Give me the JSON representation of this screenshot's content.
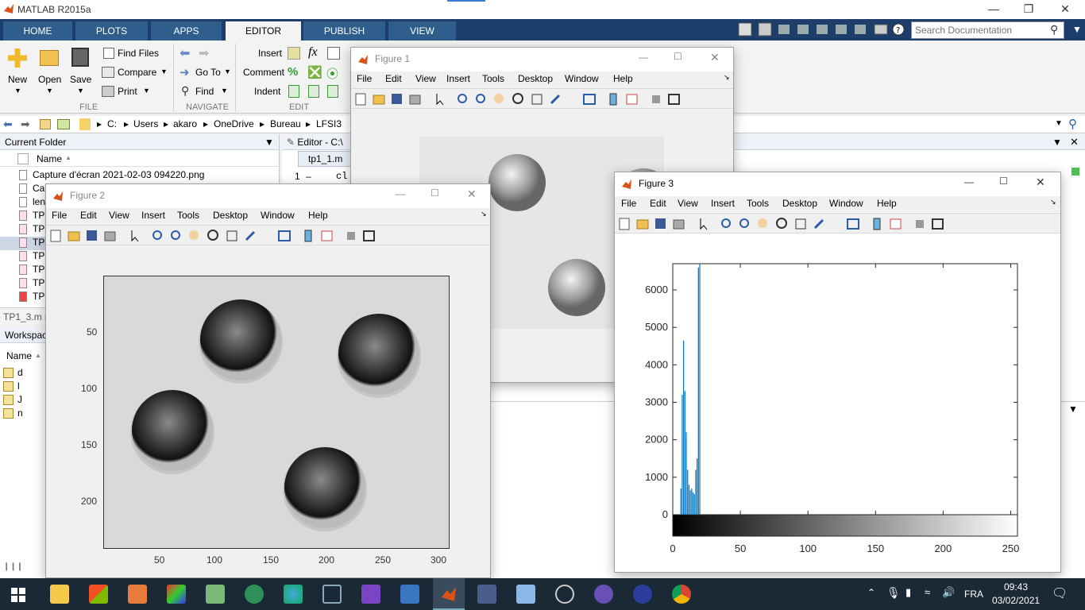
{
  "app": {
    "title": "MATLAB R2015a"
  },
  "ribbon_tabs": [
    {
      "label": "HOME"
    },
    {
      "label": "PLOTS"
    },
    {
      "label": "APPS"
    },
    {
      "label": "EDITOR"
    },
    {
      "label": "PUBLISH"
    },
    {
      "label": "VIEW"
    }
  ],
  "search": {
    "placeholder": "Search Documentation"
  },
  "ribbon": {
    "new": "New",
    "open": "Open",
    "save": "Save",
    "find_files": "Find Files",
    "compare": "Compare",
    "print": "Print",
    "go_to": "Go To",
    "find": "Find",
    "insert": "Insert",
    "comment": "Comment",
    "indent": "Indent",
    "fx": "fx",
    "sections": {
      "file": "FILE",
      "navigate": "NAVIGATE",
      "edit": "EDIT"
    }
  },
  "address": {
    "parts": [
      "C:",
      "Users",
      "akaro",
      "OneDrive",
      "Bureau",
      "LFSI3"
    ]
  },
  "current_folder": {
    "title": "Current Folder",
    "col_name": "Name",
    "files": [
      {
        "name": "Capture d'écran 2021-02-03 094220.png"
      },
      {
        "name": "Ca"
      },
      {
        "name": "len"
      },
      {
        "name": "TP"
      },
      {
        "name": "TP"
      },
      {
        "name": "TP"
      },
      {
        "name": "TP"
      },
      {
        "name": "TP"
      },
      {
        "name": "TP"
      },
      {
        "name": "TP"
      }
    ],
    "status": "TP1_3.m ("
  },
  "workspace": {
    "title": "Workspac",
    "col_name": "Name",
    "vars": [
      {
        "name": "d"
      },
      {
        "name": "l"
      },
      {
        "name": "J"
      },
      {
        "name": "n"
      }
    ]
  },
  "editor": {
    "title": "Editor - C:\\",
    "tab": "tp1_1.m",
    "line_no": "1",
    "dash": "–",
    "code": "cl"
  },
  "figure_menu": [
    "File",
    "Edit",
    "View",
    "Insert",
    "Tools",
    "Desktop",
    "Window",
    "Help"
  ],
  "figure1": {
    "title": "Figure 1"
  },
  "figure2": {
    "title": "Figure 2",
    "y_ticks": [
      "50",
      "100",
      "150",
      "200"
    ],
    "x_ticks": [
      "50",
      "100",
      "150",
      "200",
      "250",
      "300"
    ]
  },
  "figure3": {
    "title": "Figure 3"
  },
  "chart_data": {
    "type": "bar",
    "title": "",
    "xlabel": "",
    "ylabel": "",
    "xlim": [
      0,
      255
    ],
    "ylim": [
      0,
      6700
    ],
    "x_ticks": [
      "0",
      "50",
      "100",
      "150",
      "200",
      "250"
    ],
    "y_ticks": [
      "0",
      "1000",
      "2000",
      "3000",
      "4000",
      "5000",
      "6000"
    ],
    "x": [
      6,
      7,
      8,
      9,
      10,
      11,
      12,
      13,
      14,
      15,
      16,
      17,
      18,
      19,
      20
    ],
    "values": [
      700,
      3200,
      4650,
      3300,
      2200,
      1200,
      800,
      650,
      700,
      600,
      550,
      1200,
      1500,
      6600,
      6700
    ],
    "color": "#0072bd"
  },
  "taskbar": {
    "lang": "FRA",
    "time": "09:43",
    "date": "03/02/2021"
  },
  "colors": {
    "ribbon_tab_bg": "#1d3e6b",
    "matlab_accent": "#d95319"
  }
}
